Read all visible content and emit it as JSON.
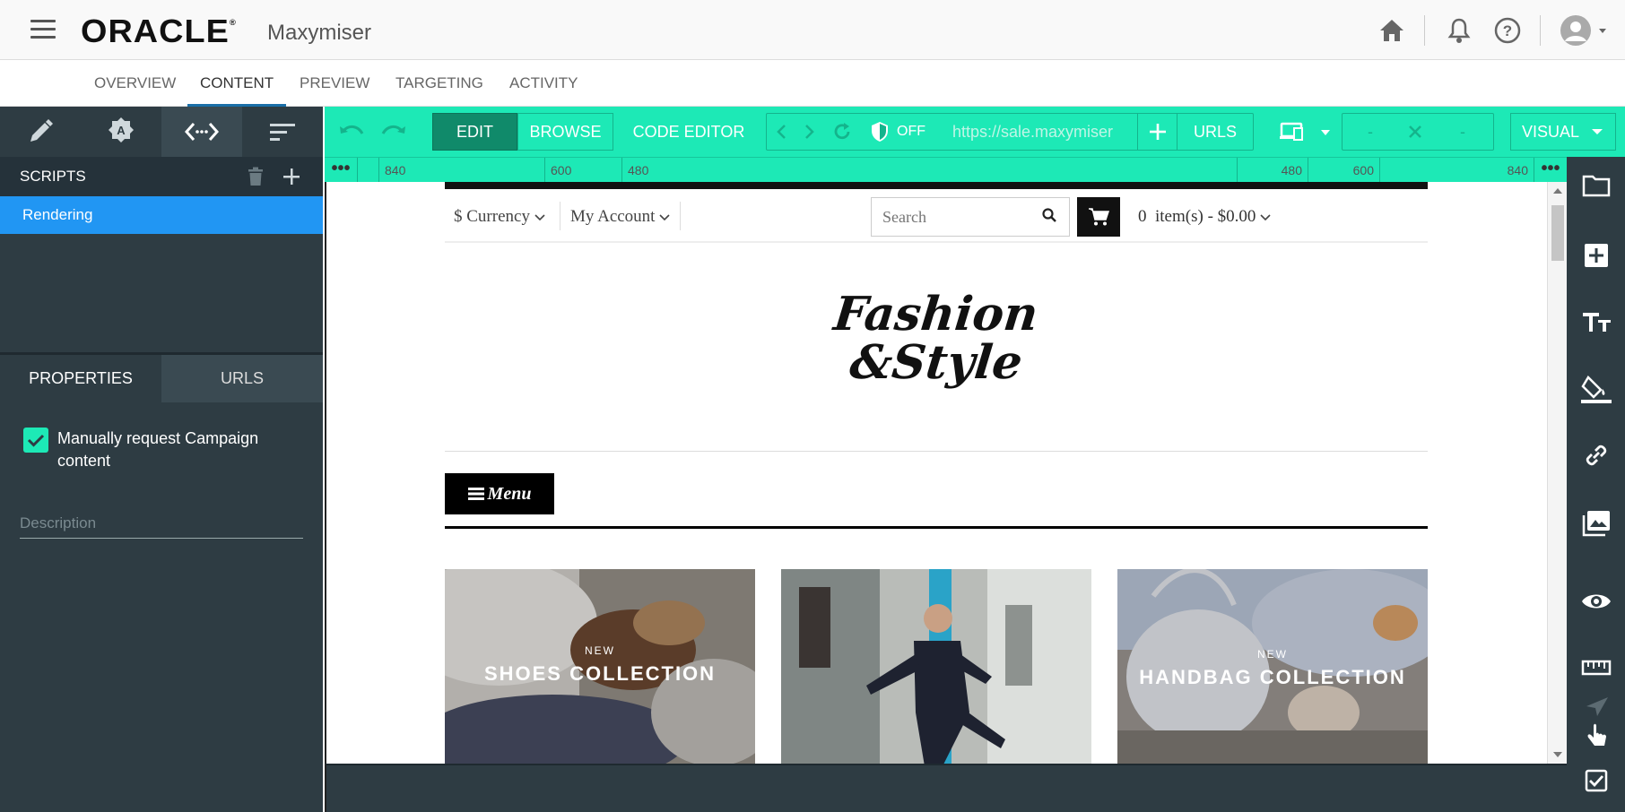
{
  "app": {
    "brand": "ORACLE",
    "product": "Maxymiser"
  },
  "nav": {
    "tabs": [
      "OVERVIEW",
      "CONTENT",
      "PREVIEW",
      "TARGETING",
      "ACTIVITY"
    ],
    "active": "CONTENT"
  },
  "scripts": {
    "title": "SCRIPTS",
    "items": [
      "Rendering"
    ]
  },
  "properties": {
    "tabs": [
      "PROPERTIES",
      "URLS"
    ],
    "checkbox_label": "Manually request Campaign content",
    "checkbox_checked": true,
    "description_placeholder": "Description"
  },
  "toolbar": {
    "edit": "EDIT",
    "browse": "BROWSE",
    "code_editor": "CODE EDITOR",
    "toggle": "OFF",
    "url": "https://sale.maxymiser",
    "urls": "URLS",
    "dash1": "-",
    "dash2": "-",
    "mode": "VISUAL"
  },
  "ruler": {
    "marks": [
      "840",
      "600",
      "480",
      "480",
      "600",
      "840"
    ]
  },
  "site": {
    "currency": "$ Currency",
    "account": "My Account",
    "search_placeholder": "Search",
    "cart": "0  item(s) - $0.00",
    "logo_line1": "Fashion",
    "logo_line2": "&Style",
    "menu": "Menu",
    "banners": [
      {
        "new": "NEW",
        "title": "SHOES COLLECTION"
      },
      {
        "new": "",
        "title": ""
      },
      {
        "new": "NEW",
        "title": "HANDBAG COLLECTION"
      }
    ]
  },
  "colors": {
    "accent": "#1de9b6",
    "panel": "#2e3c43",
    "selected": "#2196f3",
    "active_tab_underline": "#1a6fa8"
  }
}
